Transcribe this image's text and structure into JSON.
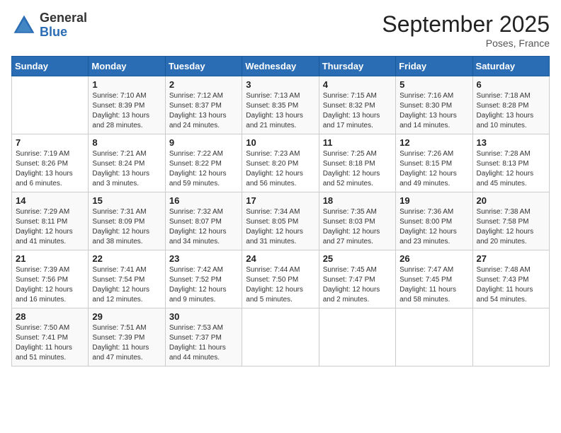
{
  "header": {
    "logo_general": "General",
    "logo_blue": "Blue",
    "month_title": "September 2025",
    "location": "Poses, France"
  },
  "days_of_week": [
    "Sunday",
    "Monday",
    "Tuesday",
    "Wednesday",
    "Thursday",
    "Friday",
    "Saturday"
  ],
  "weeks": [
    [
      {
        "day": "",
        "sunrise": "",
        "sunset": "",
        "daylight": ""
      },
      {
        "day": "1",
        "sunrise": "Sunrise: 7:10 AM",
        "sunset": "Sunset: 8:39 PM",
        "daylight": "Daylight: 13 hours and 28 minutes."
      },
      {
        "day": "2",
        "sunrise": "Sunrise: 7:12 AM",
        "sunset": "Sunset: 8:37 PM",
        "daylight": "Daylight: 13 hours and 24 minutes."
      },
      {
        "day": "3",
        "sunrise": "Sunrise: 7:13 AM",
        "sunset": "Sunset: 8:35 PM",
        "daylight": "Daylight: 13 hours and 21 minutes."
      },
      {
        "day": "4",
        "sunrise": "Sunrise: 7:15 AM",
        "sunset": "Sunset: 8:32 PM",
        "daylight": "Daylight: 13 hours and 17 minutes."
      },
      {
        "day": "5",
        "sunrise": "Sunrise: 7:16 AM",
        "sunset": "Sunset: 8:30 PM",
        "daylight": "Daylight: 13 hours and 14 minutes."
      },
      {
        "day": "6",
        "sunrise": "Sunrise: 7:18 AM",
        "sunset": "Sunset: 8:28 PM",
        "daylight": "Daylight: 13 hours and 10 minutes."
      }
    ],
    [
      {
        "day": "7",
        "sunrise": "Sunrise: 7:19 AM",
        "sunset": "Sunset: 8:26 PM",
        "daylight": "Daylight: 13 hours and 6 minutes."
      },
      {
        "day": "8",
        "sunrise": "Sunrise: 7:21 AM",
        "sunset": "Sunset: 8:24 PM",
        "daylight": "Daylight: 13 hours and 3 minutes."
      },
      {
        "day": "9",
        "sunrise": "Sunrise: 7:22 AM",
        "sunset": "Sunset: 8:22 PM",
        "daylight": "Daylight: 12 hours and 59 minutes."
      },
      {
        "day": "10",
        "sunrise": "Sunrise: 7:23 AM",
        "sunset": "Sunset: 8:20 PM",
        "daylight": "Daylight: 12 hours and 56 minutes."
      },
      {
        "day": "11",
        "sunrise": "Sunrise: 7:25 AM",
        "sunset": "Sunset: 8:18 PM",
        "daylight": "Daylight: 12 hours and 52 minutes."
      },
      {
        "day": "12",
        "sunrise": "Sunrise: 7:26 AM",
        "sunset": "Sunset: 8:15 PM",
        "daylight": "Daylight: 12 hours and 49 minutes."
      },
      {
        "day": "13",
        "sunrise": "Sunrise: 7:28 AM",
        "sunset": "Sunset: 8:13 PM",
        "daylight": "Daylight: 12 hours and 45 minutes."
      }
    ],
    [
      {
        "day": "14",
        "sunrise": "Sunrise: 7:29 AM",
        "sunset": "Sunset: 8:11 PM",
        "daylight": "Daylight: 12 hours and 41 minutes."
      },
      {
        "day": "15",
        "sunrise": "Sunrise: 7:31 AM",
        "sunset": "Sunset: 8:09 PM",
        "daylight": "Daylight: 12 hours and 38 minutes."
      },
      {
        "day": "16",
        "sunrise": "Sunrise: 7:32 AM",
        "sunset": "Sunset: 8:07 PM",
        "daylight": "Daylight: 12 hours and 34 minutes."
      },
      {
        "day": "17",
        "sunrise": "Sunrise: 7:34 AM",
        "sunset": "Sunset: 8:05 PM",
        "daylight": "Daylight: 12 hours and 31 minutes."
      },
      {
        "day": "18",
        "sunrise": "Sunrise: 7:35 AM",
        "sunset": "Sunset: 8:03 PM",
        "daylight": "Daylight: 12 hours and 27 minutes."
      },
      {
        "day": "19",
        "sunrise": "Sunrise: 7:36 AM",
        "sunset": "Sunset: 8:00 PM",
        "daylight": "Daylight: 12 hours and 23 minutes."
      },
      {
        "day": "20",
        "sunrise": "Sunrise: 7:38 AM",
        "sunset": "Sunset: 7:58 PM",
        "daylight": "Daylight: 12 hours and 20 minutes."
      }
    ],
    [
      {
        "day": "21",
        "sunrise": "Sunrise: 7:39 AM",
        "sunset": "Sunset: 7:56 PM",
        "daylight": "Daylight: 12 hours and 16 minutes."
      },
      {
        "day": "22",
        "sunrise": "Sunrise: 7:41 AM",
        "sunset": "Sunset: 7:54 PM",
        "daylight": "Daylight: 12 hours and 12 minutes."
      },
      {
        "day": "23",
        "sunrise": "Sunrise: 7:42 AM",
        "sunset": "Sunset: 7:52 PM",
        "daylight": "Daylight: 12 hours and 9 minutes."
      },
      {
        "day": "24",
        "sunrise": "Sunrise: 7:44 AM",
        "sunset": "Sunset: 7:50 PM",
        "daylight": "Daylight: 12 hours and 5 minutes."
      },
      {
        "day": "25",
        "sunrise": "Sunrise: 7:45 AM",
        "sunset": "Sunset: 7:47 PM",
        "daylight": "Daylight: 12 hours and 2 minutes."
      },
      {
        "day": "26",
        "sunrise": "Sunrise: 7:47 AM",
        "sunset": "Sunset: 7:45 PM",
        "daylight": "Daylight: 11 hours and 58 minutes."
      },
      {
        "day": "27",
        "sunrise": "Sunrise: 7:48 AM",
        "sunset": "Sunset: 7:43 PM",
        "daylight": "Daylight: 11 hours and 54 minutes."
      }
    ],
    [
      {
        "day": "28",
        "sunrise": "Sunrise: 7:50 AM",
        "sunset": "Sunset: 7:41 PM",
        "daylight": "Daylight: 11 hours and 51 minutes."
      },
      {
        "day": "29",
        "sunrise": "Sunrise: 7:51 AM",
        "sunset": "Sunset: 7:39 PM",
        "daylight": "Daylight: 11 hours and 47 minutes."
      },
      {
        "day": "30",
        "sunrise": "Sunrise: 7:53 AM",
        "sunset": "Sunset: 7:37 PM",
        "daylight": "Daylight: 11 hours and 44 minutes."
      },
      {
        "day": "",
        "sunrise": "",
        "sunset": "",
        "daylight": ""
      },
      {
        "day": "",
        "sunrise": "",
        "sunset": "",
        "daylight": ""
      },
      {
        "day": "",
        "sunrise": "",
        "sunset": "",
        "daylight": ""
      },
      {
        "day": "",
        "sunrise": "",
        "sunset": "",
        "daylight": ""
      }
    ]
  ]
}
